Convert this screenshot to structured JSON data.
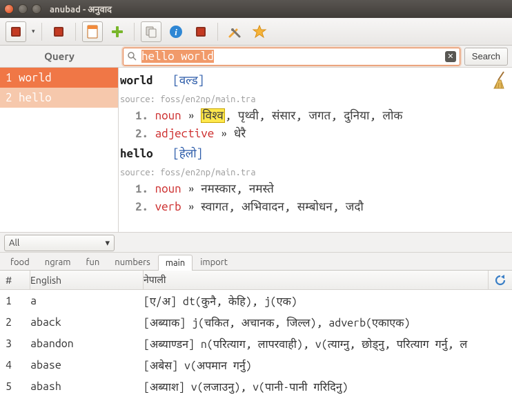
{
  "window": {
    "title": "anubad - अनुवाद"
  },
  "query": {
    "label": "Query",
    "value": "hello world",
    "search_button": "Search"
  },
  "sidebar": {
    "items": [
      {
        "label": "1 world",
        "selected": true
      },
      {
        "label": "2 hello",
        "selected": false
      }
    ]
  },
  "definitions": [
    {
      "word": "world",
      "translit": "[वल्ड]",
      "source": "source: foss/en2np/main.tra",
      "senses": [
        {
          "num": "1.",
          "pos": "noun",
          "text_hl": "विश्व",
          "text_rest": ", पृथ्वी, संसार, जगत, दुनिया, लोक"
        },
        {
          "num": "2.",
          "pos": "adjective",
          "text_hl": "",
          "text_rest": "धेरै"
        }
      ]
    },
    {
      "word": "hello",
      "translit": "[हेलो]",
      "source": "source: foss/en2np/main.tra",
      "senses": [
        {
          "num": "1.",
          "pos": "noun",
          "text_hl": "",
          "text_rest": "नमस्कार, नमस्ते"
        },
        {
          "num": "2.",
          "pos": "verb",
          "text_hl": "",
          "text_rest": "स्वागत, अभिवादन, सम्बोधन, जदौ"
        }
      ]
    }
  ],
  "filter": {
    "value": "All"
  },
  "tabs": [
    "food",
    "ngram",
    "fun",
    "numbers",
    "main",
    "import"
  ],
  "active_tab": "main",
  "table": {
    "columns": {
      "num": "#",
      "english": "English",
      "nepali": "नेपाली"
    },
    "rows": [
      {
        "n": "1",
        "en": "a",
        "np": "[ए/अ] dt(कुनै, केहि), j(एक)"
      },
      {
        "n": "2",
        "en": "aback",
        "np": "[अब्याक] j(चकित, अचानक, जिल्ल), adverb(एकाएक)"
      },
      {
        "n": "3",
        "en": "abandon",
        "np": "[अब्याण्डन] n(परित्याग, लापरवाही), v(त्याग्नु, छोड्नु, परित्याग गर्नु, ल"
      },
      {
        "n": "4",
        "en": "abase",
        "np": "[अबेस] v(अपमान गर्नु)"
      },
      {
        "n": "5",
        "en": "abash",
        "np": "[अब्याश] v(लजाउनु), v(पानी-पानी गरिदिनु)"
      }
    ]
  }
}
